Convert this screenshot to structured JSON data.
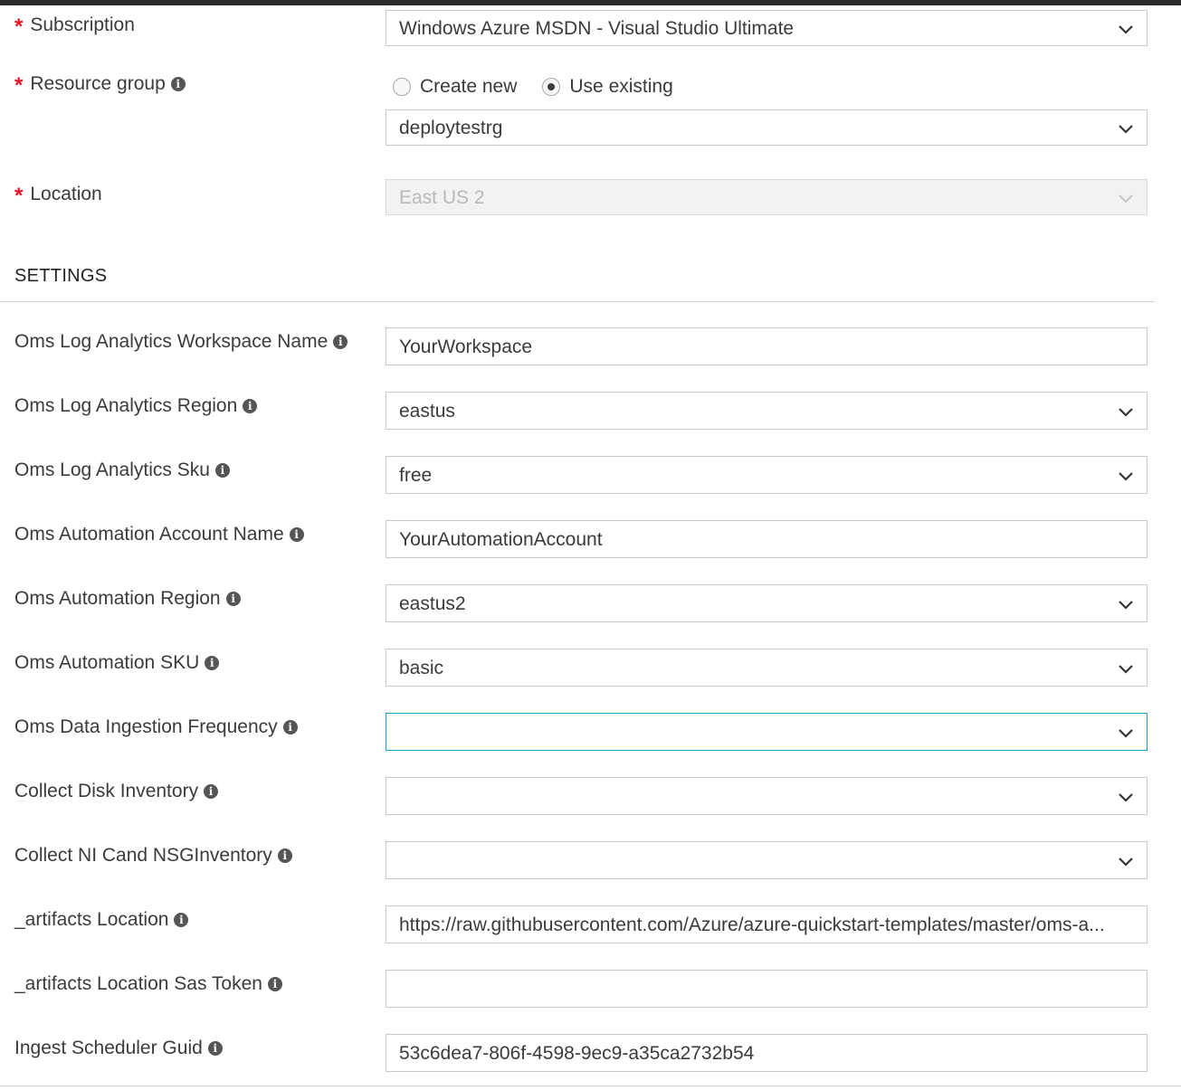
{
  "basics": {
    "subscription": {
      "label": "Subscription",
      "required_mark": "*",
      "value": "Windows Azure MSDN - Visual Studio Ultimate"
    },
    "resource_group": {
      "label": "Resource group",
      "required_mark": "*",
      "option_create_new": "Create new",
      "option_use_existing": "Use existing",
      "selected_option": "Use existing",
      "value": "deploytestrg"
    },
    "location": {
      "label": "Location",
      "required_mark": "*",
      "value": "East US 2",
      "disabled": true
    }
  },
  "settings": {
    "section_title": "SETTINGS",
    "fields": [
      {
        "label": "Oms Log Analytics Workspace Name",
        "value": "YourWorkspace",
        "type": "text"
      },
      {
        "label": "Oms Log Analytics Region",
        "value": "eastus",
        "type": "dropdown"
      },
      {
        "label": "Oms Log Analytics Sku",
        "value": "free",
        "type": "dropdown"
      },
      {
        "label": "Oms Automation Account Name",
        "value": "YourAutomationAccount",
        "type": "text"
      },
      {
        "label": "Oms Automation Region",
        "value": "eastus2",
        "type": "dropdown"
      },
      {
        "label": "Oms Automation SKU",
        "value": "basic",
        "type": "dropdown"
      },
      {
        "label": "Oms Data Ingestion Frequency",
        "value": "",
        "type": "dropdown",
        "focused": true
      },
      {
        "label": "Collect Disk Inventory",
        "value": "",
        "type": "dropdown"
      },
      {
        "label": "Collect NI Cand NSGInventory",
        "value": "",
        "type": "dropdown"
      },
      {
        "label": "_artifacts Location",
        "value": "https://raw.githubusercontent.com/Azure/azure-quickstart-templates/master/oms-a...",
        "type": "text"
      },
      {
        "label": "_artifacts Location Sas Token",
        "value": "",
        "type": "text"
      },
      {
        "label": "Ingest Scheduler Guid",
        "value": "53c6dea7-806f-4598-9ec9-a35ca2732b54",
        "type": "text"
      }
    ]
  },
  "icons": {
    "info": "info-icon",
    "chevron": "chevron-down-icon"
  },
  "colors": {
    "required": "#e81123",
    "focus_border": "#1ba1c8",
    "text": "#3b3b3b"
  }
}
